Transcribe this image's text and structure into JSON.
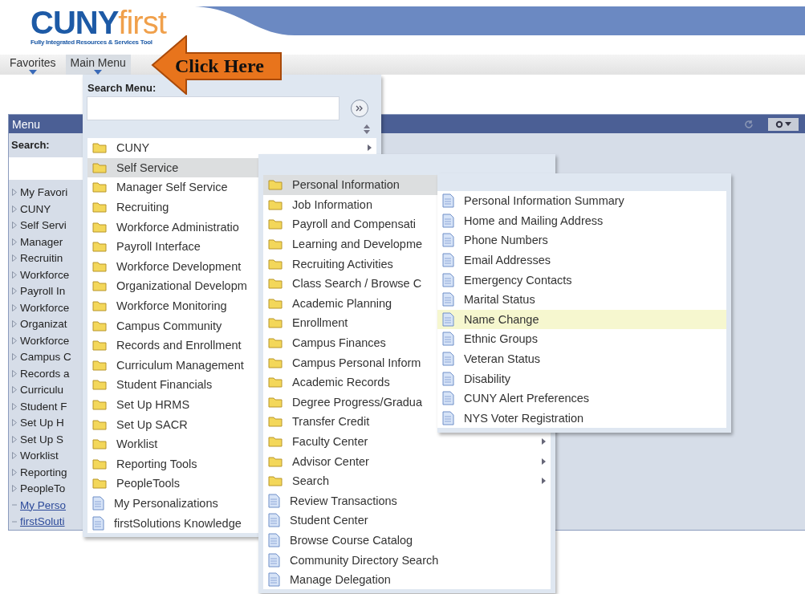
{
  "logo": {
    "brand": "CUNY",
    "brand_accent": "first",
    "tagline": "Fully Integrated Resources & Services Tool"
  },
  "nav": [
    {
      "label": "Favorites",
      "selected": false
    },
    {
      "label": "Main Menu",
      "selected": true
    }
  ],
  "callout": {
    "text": "Click Here"
  },
  "menu_panel": {
    "title": "Menu",
    "search_label": "Search:",
    "items": [
      {
        "label": "My Favori",
        "kind": "folder"
      },
      {
        "label": "CUNY",
        "kind": "folder"
      },
      {
        "label": "Self Servi",
        "kind": "folder"
      },
      {
        "label": "Manager",
        "kind": "folder"
      },
      {
        "label": "Recruitin",
        "kind": "folder"
      },
      {
        "label": "Workforce",
        "kind": "folder"
      },
      {
        "label": "Payroll In",
        "kind": "folder"
      },
      {
        "label": "Workforce",
        "kind": "folder"
      },
      {
        "label": "Organizat",
        "kind": "folder"
      },
      {
        "label": "Workforce",
        "kind": "folder"
      },
      {
        "label": "Campus C",
        "kind": "folder"
      },
      {
        "label": "Records a",
        "kind": "folder"
      },
      {
        "label": "Curriculu",
        "kind": "folder"
      },
      {
        "label": "Student F",
        "kind": "folder"
      },
      {
        "label": "Set Up H",
        "kind": "folder"
      },
      {
        "label": "Set Up S",
        "kind": "folder"
      },
      {
        "label": "Worklist",
        "kind": "folder"
      },
      {
        "label": "Reporting",
        "kind": "folder"
      },
      {
        "label": "PeopleTo",
        "kind": "folder"
      },
      {
        "label": "My Perso",
        "kind": "link"
      },
      {
        "label": "firstSoluti",
        "kind": "link"
      }
    ]
  },
  "main_menu": {
    "search_label": "Search Menu:",
    "items": [
      {
        "label": "CUNY",
        "kind": "folder",
        "selected": false,
        "arrow": true
      },
      {
        "label": "Self Service",
        "kind": "folder",
        "selected": true,
        "arrow": false
      },
      {
        "label": "Manager Self Service",
        "kind": "folder",
        "selected": false,
        "arrow": false
      },
      {
        "label": "Recruiting",
        "kind": "folder",
        "selected": false,
        "arrow": false
      },
      {
        "label": "Workforce Administratio",
        "kind": "folder",
        "selected": false,
        "arrow": false
      },
      {
        "label": "Payroll Interface",
        "kind": "folder",
        "selected": false,
        "arrow": false
      },
      {
        "label": "Workforce Development",
        "kind": "folder",
        "selected": false,
        "arrow": false
      },
      {
        "label": "Organizational Developm",
        "kind": "folder",
        "selected": false,
        "arrow": false
      },
      {
        "label": "Workforce Monitoring",
        "kind": "folder",
        "selected": false,
        "arrow": false
      },
      {
        "label": "Campus Community",
        "kind": "folder",
        "selected": false,
        "arrow": false
      },
      {
        "label": "Records and Enrollment",
        "kind": "folder",
        "selected": false,
        "arrow": false
      },
      {
        "label": "Curriculum Management",
        "kind": "folder",
        "selected": false,
        "arrow": false
      },
      {
        "label": "Student Financials",
        "kind": "folder",
        "selected": false,
        "arrow": false
      },
      {
        "label": "Set Up HRMS",
        "kind": "folder",
        "selected": false,
        "arrow": false
      },
      {
        "label": "Set Up SACR",
        "kind": "folder",
        "selected": false,
        "arrow": false
      },
      {
        "label": "Worklist",
        "kind": "folder",
        "selected": false,
        "arrow": false
      },
      {
        "label": "Reporting Tools",
        "kind": "folder",
        "selected": false,
        "arrow": false
      },
      {
        "label": "PeopleTools",
        "kind": "folder",
        "selected": false,
        "arrow": false
      },
      {
        "label": "My Personalizations",
        "kind": "page",
        "selected": false,
        "arrow": false
      },
      {
        "label": "firstSolutions Knowledge",
        "kind": "page",
        "selected": false,
        "arrow": false
      }
    ]
  },
  "self_service_menu": {
    "items": [
      {
        "label": "Personal Information",
        "kind": "folder",
        "selected": true,
        "arrow": false
      },
      {
        "label": "Job Information",
        "kind": "folder",
        "selected": false,
        "arrow": false
      },
      {
        "label": "Payroll and Compensati",
        "kind": "folder",
        "selected": false,
        "arrow": false
      },
      {
        "label": "Learning and Developme",
        "kind": "folder",
        "selected": false,
        "arrow": false
      },
      {
        "label": "Recruiting Activities",
        "kind": "folder",
        "selected": false,
        "arrow": false
      },
      {
        "label": "Class Search / Browse C",
        "kind": "folder",
        "selected": false,
        "arrow": false
      },
      {
        "label": "Academic Planning",
        "kind": "folder",
        "selected": false,
        "arrow": false
      },
      {
        "label": "Enrollment",
        "kind": "folder",
        "selected": false,
        "arrow": false
      },
      {
        "label": "Campus Finances",
        "kind": "folder",
        "selected": false,
        "arrow": false
      },
      {
        "label": "Campus Personal Inform",
        "kind": "folder",
        "selected": false,
        "arrow": false
      },
      {
        "label": "Academic Records",
        "kind": "folder",
        "selected": false,
        "arrow": false
      },
      {
        "label": "Degree Progress/Gradua",
        "kind": "folder",
        "selected": false,
        "arrow": false
      },
      {
        "label": "Transfer Credit",
        "kind": "folder",
        "selected": false,
        "arrow": false
      },
      {
        "label": "Faculty Center",
        "kind": "folder",
        "selected": false,
        "arrow": true
      },
      {
        "label": "Advisor Center",
        "kind": "folder",
        "selected": false,
        "arrow": true
      },
      {
        "label": "Search",
        "kind": "folder",
        "selected": false,
        "arrow": true
      },
      {
        "label": "Review Transactions",
        "kind": "page",
        "selected": false,
        "arrow": false
      },
      {
        "label": "Student Center",
        "kind": "page",
        "selected": false,
        "arrow": false
      },
      {
        "label": "Browse Course Catalog",
        "kind": "page",
        "selected": false,
        "arrow": false
      },
      {
        "label": "Community Directory Search",
        "kind": "page",
        "selected": false,
        "arrow": false
      },
      {
        "label": "Manage Delegation",
        "kind": "page",
        "selected": false,
        "arrow": false
      }
    ]
  },
  "personal_information_menu": {
    "items": [
      {
        "label": "Personal Information Summary",
        "kind": "page",
        "selected": false
      },
      {
        "label": "Home and Mailing Address",
        "kind": "page",
        "selected": false
      },
      {
        "label": "Phone Numbers",
        "kind": "page",
        "selected": false
      },
      {
        "label": "Email Addresses",
        "kind": "page",
        "selected": false
      },
      {
        "label": "Emergency Contacts",
        "kind": "page",
        "selected": false
      },
      {
        "label": "Marital Status",
        "kind": "page",
        "selected": false
      },
      {
        "label": "Name Change",
        "kind": "page",
        "selected": true
      },
      {
        "label": "Ethnic Groups",
        "kind": "page",
        "selected": false
      },
      {
        "label": "Veteran Status",
        "kind": "page",
        "selected": false
      },
      {
        "label": "Disability",
        "kind": "page",
        "selected": false
      },
      {
        "label": "CUNY Alert Preferences",
        "kind": "page",
        "selected": false
      },
      {
        "label": "NYS Voter Registration",
        "kind": "page",
        "selected": false
      }
    ]
  }
}
